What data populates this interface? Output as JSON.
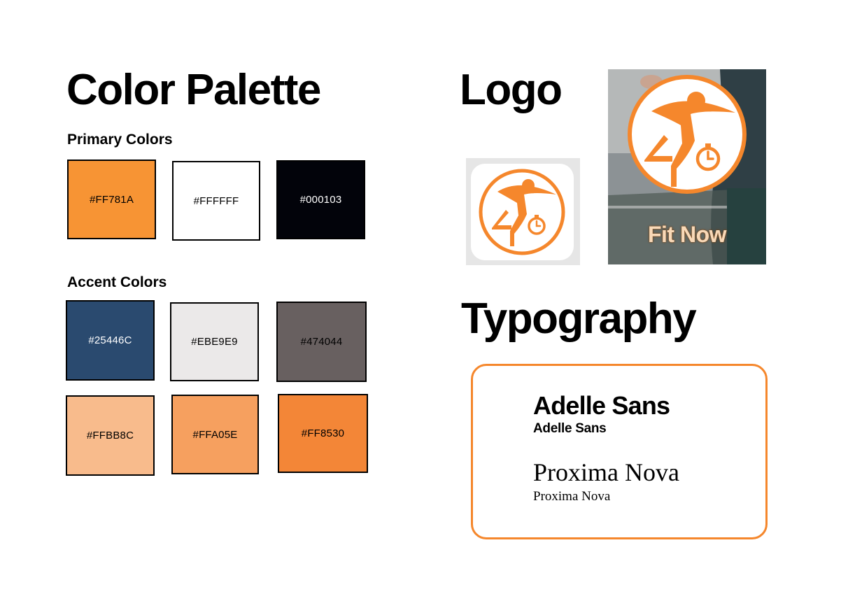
{
  "palette": {
    "title": "Color Palette",
    "primary_heading": "Primary Colors",
    "primary": [
      {
        "hex": "#FF781A",
        "label": "#FF781A"
      },
      {
        "hex": "#FFFFFF",
        "label": "#FFFFFF"
      },
      {
        "hex": "#000103",
        "label": "#000103"
      }
    ],
    "accent_heading": "Accent Colors",
    "accent": [
      {
        "hex": "#25446C",
        "label": "#25446C"
      },
      {
        "hex": "#EBE9E9",
        "label": "#EBE9E9"
      },
      {
        "hex": "#474044",
        "label": "#474044"
      },
      {
        "hex": "#FFBB8C",
        "label": "#FFBB8C"
      },
      {
        "hex": "#FFA05E",
        "label": "#FFA05E"
      },
      {
        "hex": "#FF8530",
        "label": "#FF8530"
      }
    ]
  },
  "logo": {
    "title": "Logo",
    "icon": "runner-stopwatch-icon",
    "brand_color": "#F5872C",
    "brand_name": "Fit Now"
  },
  "typography": {
    "title": "Typography",
    "border_color": "#F5872C",
    "fonts": [
      {
        "display": "Adelle Sans",
        "sample": "Adelle Sans"
      },
      {
        "display": "Proxima Nova",
        "sample": "Proxima Nova"
      }
    ]
  }
}
